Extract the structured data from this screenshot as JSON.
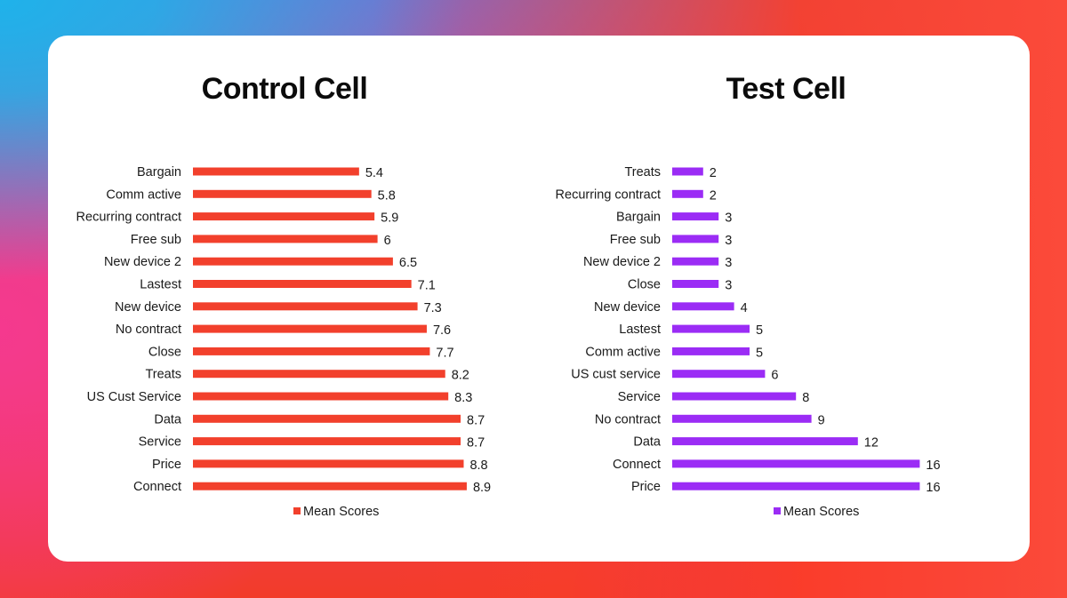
{
  "chart_data": [
    {
      "type": "bar",
      "orientation": "horizontal",
      "title": "Control Cell",
      "categories": [
        "Bargain",
        "Comm active",
        "Recurring contract",
        "Free sub",
        "New device 2",
        "Lastest",
        "New device",
        "No contract",
        "Close",
        "Treats",
        "US Cust Service",
        "Data",
        "Service",
        "Price",
        "Connect"
      ],
      "series": [
        {
          "name": "Mean Scores",
          "color": "#f2402c",
          "values": [
            5.4,
            5.8,
            5.9,
            6,
            6.5,
            7.1,
            7.3,
            7.6,
            7.7,
            8.2,
            8.3,
            8.7,
            8.7,
            8.8,
            8.9
          ],
          "value_labels": [
            "5.4",
            "5.8",
            "5.9",
            "6",
            "6.5",
            "7.1",
            "7.3",
            "7.6",
            "7.7",
            "8.2",
            "8.3",
            "8.7",
            "8.7",
            "8.8",
            "8.9"
          ]
        }
      ],
      "xlabel": "",
      "ylabel": "",
      "xlim": [
        0,
        8.9
      ],
      "grid": false,
      "legend": {
        "placement": "bottom",
        "label": "Mean Scores"
      }
    },
    {
      "type": "bar",
      "orientation": "horizontal",
      "title": "Test Cell",
      "categories": [
        "Treats",
        "Recurring contract",
        "Bargain",
        "Free sub",
        "New device 2",
        "Close",
        "New device",
        "Lastest",
        "Comm active",
        "US cust service",
        "Service",
        "No contract",
        "Data",
        "Connect",
        "Price"
      ],
      "series": [
        {
          "name": "Mean Scores",
          "color": "#9b2cf5",
          "values": [
            2,
            2,
            3,
            3,
            3,
            3,
            4,
            5,
            5,
            6,
            8,
            9,
            12,
            16,
            16
          ],
          "value_labels": [
            "2",
            "2",
            "3",
            "3",
            "3",
            "3",
            "4",
            "5",
            "5",
            "6",
            "8",
            "9",
            "12",
            "16",
            "16"
          ]
        }
      ],
      "xlabel": "",
      "ylabel": "",
      "xlim": [
        0,
        16
      ],
      "grid": false,
      "legend": {
        "placement": "bottom",
        "label": "Mean Scores"
      }
    }
  ]
}
